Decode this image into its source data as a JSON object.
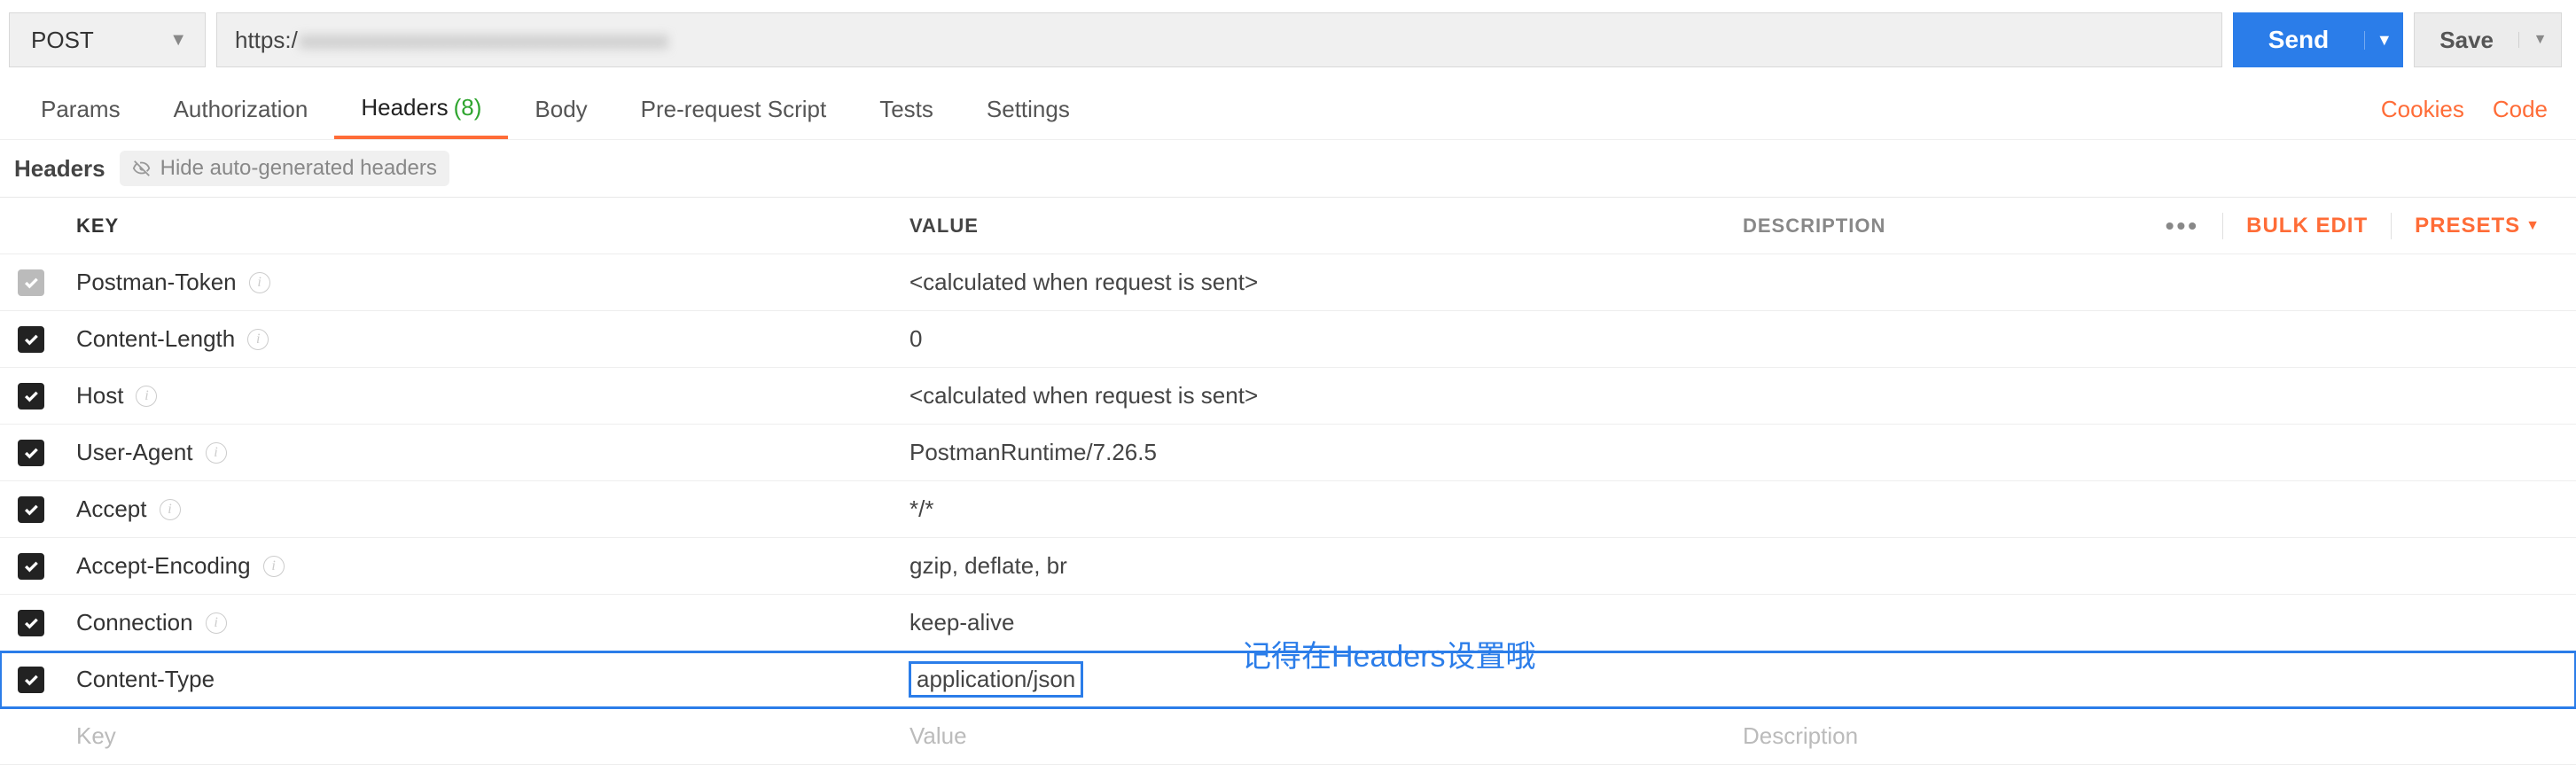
{
  "request": {
    "method": "POST",
    "url_prefix": "https:/",
    "url_blurred": "xxxxxxxxxxxxxxxxxxxxxxxxxxxxxxxx"
  },
  "buttons": {
    "send": "Send",
    "save": "Save"
  },
  "tabs": {
    "params": "Params",
    "authorization": "Authorization",
    "headers": "Headers",
    "headers_count": "(8)",
    "body": "Body",
    "prerequest": "Pre-request Script",
    "tests": "Tests",
    "settings": "Settings",
    "cookies": "Cookies",
    "code": "Code"
  },
  "subheader": {
    "title": "Headers",
    "hide_label": "Hide auto-generated headers"
  },
  "columns": {
    "key": "KEY",
    "value": "VALUE",
    "description": "DESCRIPTION",
    "bulk_edit": "Bulk Edit",
    "presets": "Presets"
  },
  "headers": [
    {
      "key": "Postman-Token",
      "value": "<calculated when request is sent>",
      "auto": true,
      "info": true
    },
    {
      "key": "Content-Length",
      "value": "0",
      "auto": false,
      "info": true
    },
    {
      "key": "Host",
      "value": "<calculated when request is sent>",
      "auto": false,
      "info": true
    },
    {
      "key": "User-Agent",
      "value": "PostmanRuntime/7.26.5",
      "auto": false,
      "info": true
    },
    {
      "key": "Accept",
      "value": "*/*",
      "auto": false,
      "info": true
    },
    {
      "key": "Accept-Encoding",
      "value": "gzip, deflate, br",
      "auto": false,
      "info": true
    },
    {
      "key": "Connection",
      "value": "keep-alive",
      "auto": false,
      "info": true
    },
    {
      "key": "Content-Type",
      "value": "application/json",
      "auto": false,
      "info": false,
      "highlight": true
    }
  ],
  "placeholders": {
    "key": "Key",
    "value": "Value",
    "description": "Description"
  },
  "annotation": "记得在Headers设置哦"
}
